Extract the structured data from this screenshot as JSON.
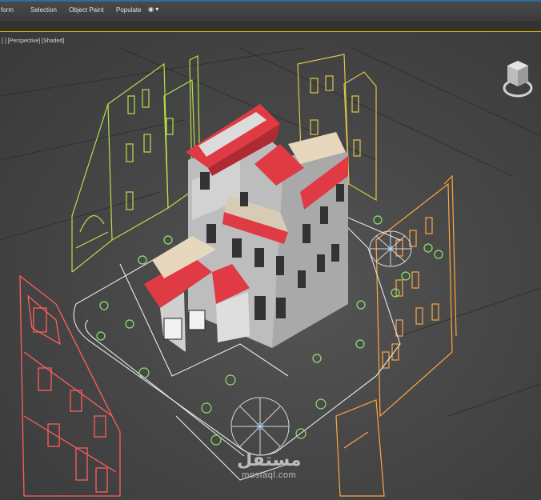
{
  "ribbon": {
    "tabs": [
      "form",
      "Selection",
      "Object Paint",
      "Populate"
    ],
    "extra_icon": "settings-dropdown-icon",
    "accent_color": "#e1b800"
  },
  "viewport": {
    "label": "[ ] [Perspective] [Shaded]",
    "background": "#444444"
  },
  "scene": {
    "roof_color": "#e03a45",
    "wall_color": "#c9c9c9",
    "wire_colors": {
      "left_building": "#ff5e5e",
      "back_left_building": "#b6e04a",
      "back_right_building": "#d9c84a",
      "right_building": "#ffa640",
      "site_lines": "#e8e8e8",
      "trees": "#8fe36d",
      "light_gizmo": "#6bb8ff"
    }
  },
  "watermark": {
    "arabic": "مستقل",
    "latin": "mostaql.com"
  }
}
